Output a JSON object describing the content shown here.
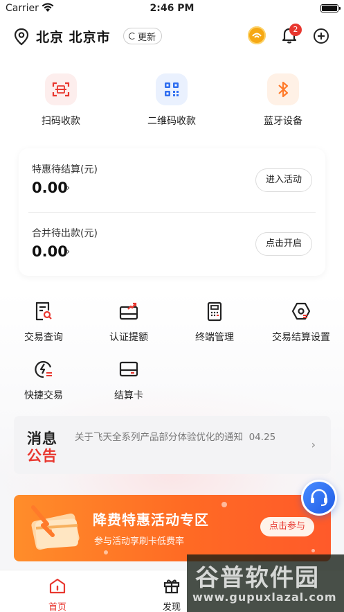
{
  "status_bar": {
    "carrier": "Carrier",
    "time": "2:46 PM"
  },
  "header": {
    "location": "北京 北京市",
    "refresh_label": "更新",
    "notification_count": "2"
  },
  "quick_actions": [
    {
      "label": "扫码收款",
      "icon": "scan-icon"
    },
    {
      "label": "二维码收款",
      "icon": "qrcode-icon"
    },
    {
      "label": "蓝牙设备",
      "icon": "bluetooth-icon"
    }
  ],
  "pending": {
    "special": {
      "title": "特惠待结算(元)",
      "amount": "0.00",
      "button": "进入活动"
    },
    "merged": {
      "title": "合并待出款(元)",
      "amount": "0.00",
      "button": "点击开启"
    }
  },
  "features": [
    {
      "label": "交易查询",
      "icon": "receipt-search-icon"
    },
    {
      "label": "认证提额",
      "icon": "limit-up-icon"
    },
    {
      "label": "终端管理",
      "icon": "terminal-icon"
    },
    {
      "label": "交易结算设置",
      "icon": "settle-settings-icon"
    },
    {
      "label": "快捷交易",
      "icon": "quick-trade-icon"
    },
    {
      "label": "结算卡",
      "icon": "card-icon"
    }
  ],
  "notice": {
    "logo_line1": "消息",
    "logo_line2": "公告",
    "text": "关于飞天全系列产品部分体验优化的通知",
    "date": "04.25"
  },
  "promo": {
    "title": "降费特惠活动专区",
    "subtitle": "参与活动享刷卡低费率",
    "cta": "点击参与"
  },
  "tabs": [
    {
      "label": "首页",
      "icon": "home-icon",
      "active": true
    },
    {
      "label": "发现",
      "icon": "gift-icon",
      "active": false
    }
  ],
  "watermark": {
    "brand": "谷普软件园",
    "url": "www.gupuxlazal.com"
  },
  "colors": {
    "accent": "#e8372f",
    "orange": "#ff7a2a",
    "blue": "#2f6ef0"
  }
}
